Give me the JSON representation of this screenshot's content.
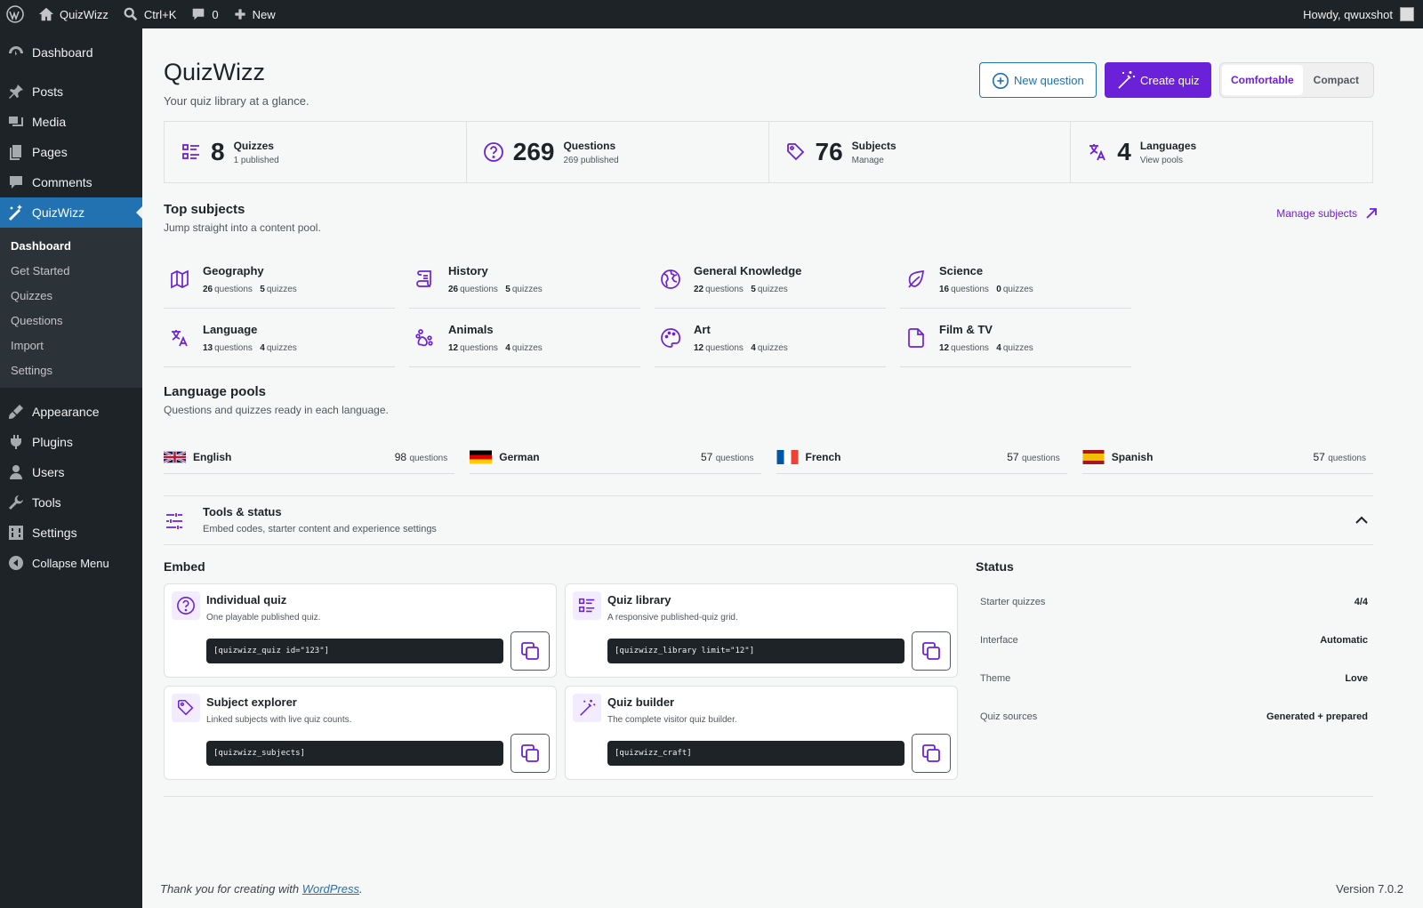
{
  "adminbar": {
    "site_name": "QuizWizz",
    "search_shortcut": "Ctrl+K",
    "comments_count": "0",
    "new_label": "New",
    "howdy": "Howdy, qwuxshot"
  },
  "sidebar": {
    "items": [
      {
        "label": "Dashboard",
        "icon": "dashboard-icon"
      },
      {
        "label": "Posts",
        "icon": "pin-icon"
      },
      {
        "label": "Media",
        "icon": "media-icon"
      },
      {
        "label": "Pages",
        "icon": "pages-icon"
      },
      {
        "label": "Comments",
        "icon": "comment-icon"
      },
      {
        "label": "QuizWizz",
        "icon": "magic-wand-icon"
      },
      {
        "label": "Appearance",
        "icon": "brush-icon"
      },
      {
        "label": "Plugins",
        "icon": "plugin-icon"
      },
      {
        "label": "Users",
        "icon": "user-icon"
      },
      {
        "label": "Tools",
        "icon": "wrench-icon"
      },
      {
        "label": "Settings",
        "icon": "settings-icon"
      },
      {
        "label": "Collapse Menu",
        "icon": "collapse-icon"
      }
    ],
    "submenu": [
      "Dashboard",
      "Get Started",
      "Quizzes",
      "Questions",
      "Import",
      "Settings"
    ]
  },
  "header": {
    "title": "QuizWizz",
    "subtitle": "Your quiz library at a glance.",
    "new_question": "New question",
    "create_quiz": "Create quiz",
    "density_comfortable": "Comfortable",
    "density_compact": "Compact"
  },
  "stats": [
    {
      "num": "8",
      "label": "Quizzes",
      "sub": "1 published",
      "icon": "list-icon"
    },
    {
      "num": "269",
      "label": "Questions",
      "sub": "269 published",
      "icon": "question-icon"
    },
    {
      "num": "76",
      "label": "Subjects",
      "sub": "Manage",
      "icon": "tag-icon"
    },
    {
      "num": "4",
      "label": "Languages",
      "sub": "View pools",
      "icon": "translate-icon"
    }
  ],
  "top_subjects": {
    "title": "Top subjects",
    "subtitle": "Jump straight into a content pool.",
    "manage": "Manage subjects",
    "questions_word": "questions",
    "quizzes_word": "quizzes",
    "items": [
      {
        "name": "Geography",
        "questions": "26",
        "quizzes": "5",
        "icon": "map-icon"
      },
      {
        "name": "History",
        "questions": "26",
        "quizzes": "5",
        "icon": "scroll-icon"
      },
      {
        "name": "General Knowledge",
        "questions": "22",
        "quizzes": "5",
        "icon": "globe-icon"
      },
      {
        "name": "Science",
        "questions": "16",
        "quizzes": "0",
        "icon": "leaf-icon"
      },
      {
        "name": "Language",
        "questions": "13",
        "quizzes": "4",
        "icon": "translate-icon"
      },
      {
        "name": "Animals",
        "questions": "12",
        "quizzes": "4",
        "icon": "paw-icon"
      },
      {
        "name": "Art",
        "questions": "12",
        "quizzes": "4",
        "icon": "palette-icon"
      },
      {
        "name": "Film & TV",
        "questions": "12",
        "quizzes": "4",
        "icon": "file-icon"
      }
    ]
  },
  "language_pools": {
    "title": "Language pools",
    "subtitle": "Questions and quizzes ready in each language.",
    "questions_word": "questions",
    "items": [
      {
        "name": "English",
        "count": "98"
      },
      {
        "name": "German",
        "count": "57"
      },
      {
        "name": "French",
        "count": "57"
      },
      {
        "name": "Spanish",
        "count": "57"
      }
    ]
  },
  "tools": {
    "title": "Tools & status",
    "subtitle": "Embed codes, starter content and experience settings"
  },
  "embed": {
    "title": "Embed",
    "cards": [
      {
        "title": "Individual quiz",
        "sub": "One playable published quiz.",
        "code": "[quizwizz_quiz id=\"123\"]",
        "icon": "question-icon"
      },
      {
        "title": "Quiz library",
        "sub": "A responsive published-quiz grid.",
        "code": "[quizwizz_library limit=\"12\"]",
        "icon": "list-icon"
      },
      {
        "title": "Subject explorer",
        "sub": "Linked subjects with live quiz counts.",
        "code": "[quizwizz_subjects]",
        "icon": "tag-icon"
      },
      {
        "title": "Quiz builder",
        "sub": "The complete visitor quiz builder.",
        "code": "[quizwizz_craft]",
        "icon": "magic-wand-icon"
      }
    ]
  },
  "status": {
    "title": "Status",
    "rows": [
      {
        "label": "Starter quizzes",
        "value": "4/4"
      },
      {
        "label": "Interface",
        "value": "Automatic"
      },
      {
        "label": "Theme",
        "value": "Love"
      },
      {
        "label": "Quiz sources",
        "value": "Generated + prepared"
      }
    ]
  },
  "footer": {
    "thanks_prefix": "Thank you for creating with ",
    "link": "WordPress",
    "thanks_suffix": ".",
    "version": "Version 7.0.2"
  },
  "colors": {
    "accent": "#6b21d8",
    "admin_blue": "#2271b1",
    "dark": "#1d2327"
  }
}
